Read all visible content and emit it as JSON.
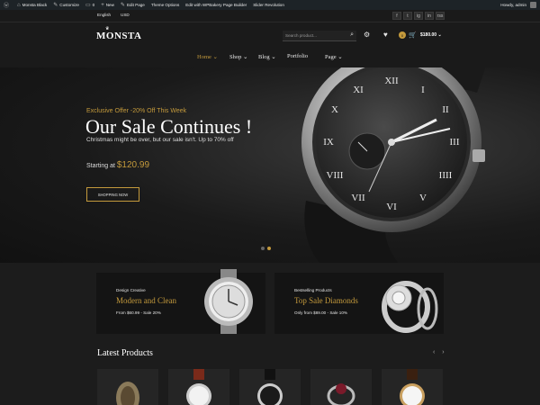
{
  "admin_bar": {
    "site": "Monsta Black",
    "customize": "Customize",
    "comments": "0",
    "new": "New",
    "edit_page": "Edit Page",
    "theme_options": "Theme Options",
    "wpbakery": "Edit with WPBakery Page Builder",
    "slider": "Slider Revolution",
    "howdy": "Howdy, admin"
  },
  "topbar": {
    "language": "English",
    "currency": "USD",
    "socials": [
      "f",
      "t",
      "ig",
      "in",
      "rss"
    ]
  },
  "header": {
    "logo": "MONSTA",
    "search_placeholder": "Search product...",
    "cart_count": "0",
    "cart_total": "$180.00"
  },
  "nav": {
    "items": [
      "Home",
      "Shop",
      "Blog",
      "Portfolio",
      "Page"
    ]
  },
  "hero": {
    "offer": "Exclusive Offer -20% Off This Week",
    "title": "Our Sale Continues !",
    "subtitle": "Christmas might be over, but our sale isn't. Up to 70% off",
    "starting_label": "Starting at",
    "price": "$120.99",
    "button": "SHOPPING NOW"
  },
  "promos": [
    {
      "tag": "Design Creative",
      "title": "Modern and Clean",
      "price": "From $60.99 - Sale 20%"
    },
    {
      "tag": "Bestselling Products",
      "title": "Top Sale Diamonds",
      "price": "Only from $89.00 - Sale 10%"
    }
  ],
  "latest": {
    "title": "Latest Products",
    "prev": "‹",
    "next": "›"
  },
  "colors": {
    "accent": "#c49a3c",
    "background": "#1c1c1c"
  }
}
